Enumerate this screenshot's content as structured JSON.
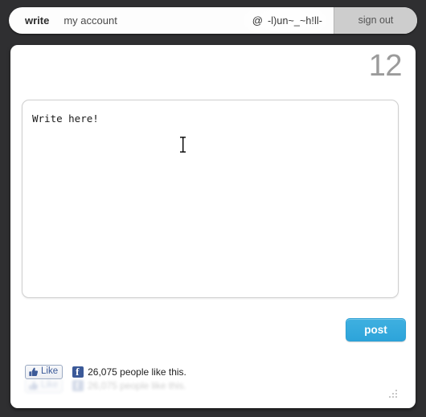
{
  "window": {
    "background_color": "#2f2f31"
  },
  "topbar": {
    "nav_items": [
      {
        "label": "write",
        "active": true
      },
      {
        "label": "my account",
        "active": false
      }
    ],
    "account": {
      "at_symbol": "@",
      "username": "-l)un~_~h!ll-"
    },
    "signout_label": "sign out"
  },
  "card": {
    "counter": "12",
    "composer": {
      "value": "Write here!",
      "placeholder": "Write here!"
    },
    "post_label": "post",
    "social": {
      "like_label": "Like",
      "like_count_text": "26,075 people like this.",
      "brand_color": "#3b5998"
    }
  },
  "colors": {
    "accent_blue": "#2da4da",
    "counter_gray": "#9b9b9b",
    "facebook_blue": "#3b5998",
    "signout_gray": "#cdcdcd"
  },
  "icons": {
    "thumbs_up": "thumbs-up-icon",
    "facebook": "facebook-icon",
    "resize_grip": "resize-grip-icon",
    "text_cursor": "text-cursor-icon"
  }
}
